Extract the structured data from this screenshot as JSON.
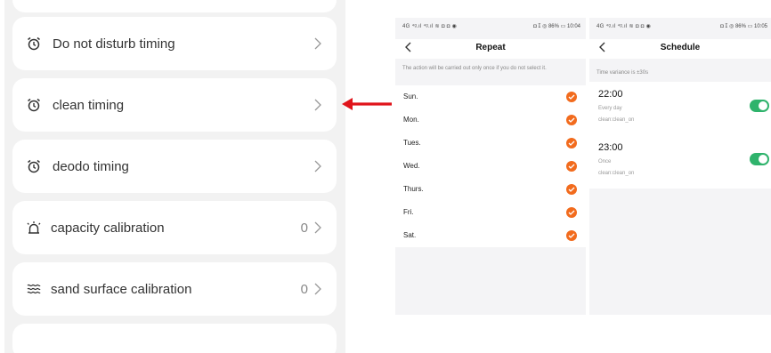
{
  "settings": {
    "items": [
      {
        "label": "Do not disturb timing",
        "icon": "alarm-clock-icon",
        "value": ""
      },
      {
        "label": "clean timing",
        "icon": "alarm-clock-icon",
        "value": ""
      },
      {
        "label": "deodo timing",
        "icon": "alarm-clock-icon",
        "value": ""
      },
      {
        "label": "capacity calibration",
        "icon": "bell-alert-icon",
        "value": "0"
      },
      {
        "label": "sand surface calibration",
        "icon": "wave-lines-icon",
        "value": "0"
      }
    ]
  },
  "repeat_screen": {
    "status_left": "4G ⁴ᵍ.ıl ⁴ᵍ.ıl ≋ ◘ ◘ ◉",
    "status_right": "◘ ⵊ ◎ 86% ▭ 10:04",
    "title": "Repeat",
    "hint": "The action will be carried out only once if you do not select it.",
    "days": [
      "Sun.",
      "Mon.",
      "Tues.",
      "Wed.",
      "Thurs.",
      "Fri.",
      "Sat."
    ],
    "check_color": "#f26b1d"
  },
  "schedule_screen": {
    "status_left": "4G ⁴ᵍ.ıl ⁴ᵍ.ıl ≋ ◘ ◘ ◉",
    "status_right": "◘ ⵊ ◎ 86% ▭ 10:05",
    "title": "Schedule",
    "hint": "Time variance is ±30s",
    "items": [
      {
        "time": "22:00",
        "repeat": "Every day",
        "action": "clean:clean_on",
        "enabled": true
      },
      {
        "time": "23:00",
        "repeat": "Once",
        "action": "clean:clean_on",
        "enabled": true
      }
    ],
    "toggle_color": "#2fb36c"
  },
  "arrow_color": "#e0141b"
}
